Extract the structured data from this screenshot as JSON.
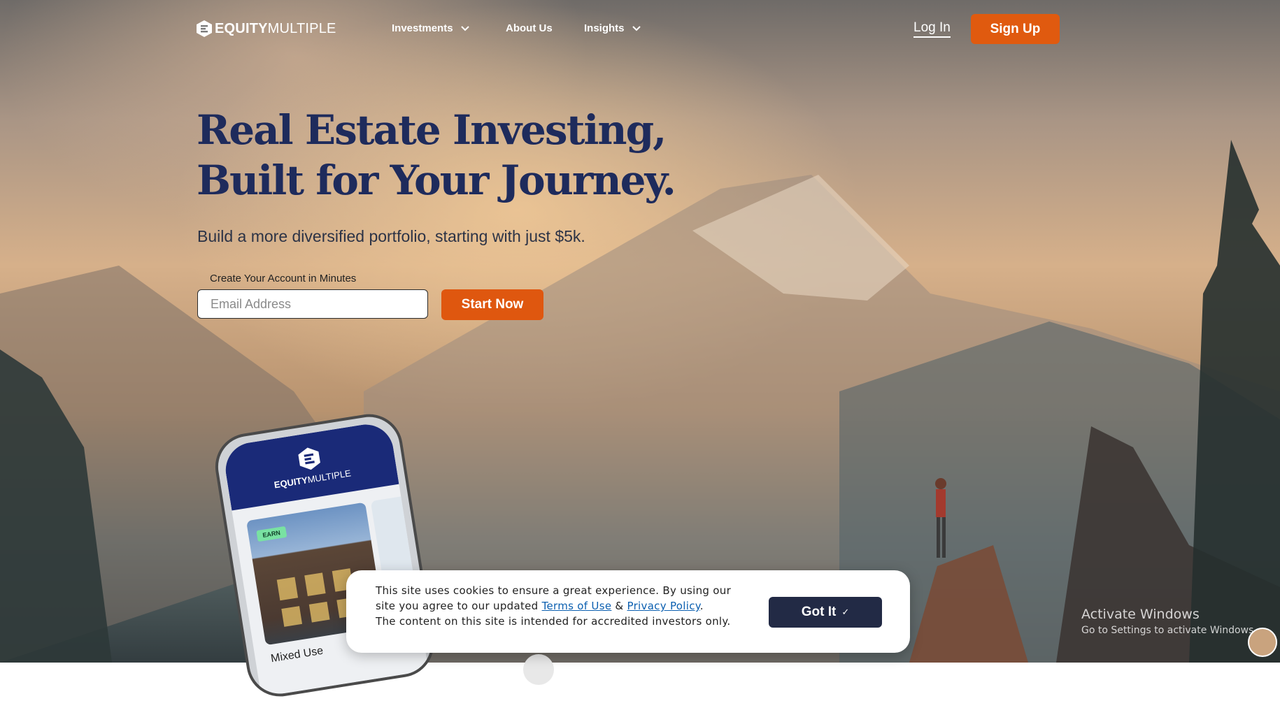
{
  "brand": {
    "bold": "EQUITY",
    "light": "MULTIPLE"
  },
  "nav": {
    "items": [
      {
        "label": "Investments",
        "has_dropdown": true
      },
      {
        "label": "About Us",
        "has_dropdown": false
      },
      {
        "label": "Insights",
        "has_dropdown": true
      }
    ],
    "login_label": "Log In",
    "signup_label": "Sign Up"
  },
  "hero": {
    "title_line1": "Real Estate Investing,",
    "title_line2": "Built for Your Journey.",
    "subtitle": "Build a more diversified portfolio, starting with just $5k.",
    "field_label": "Create Your Account in Minutes",
    "email_placeholder": "Email Address",
    "cta_label": "Start Now"
  },
  "phone": {
    "brand_bold": "EQUITY",
    "brand_light": "MULTIPLE",
    "badge": "EARN",
    "card_title": "Mixed Use"
  },
  "cookie": {
    "text_before": "This site uses cookies to ensure a great experience. By using our site you agree to our updated ",
    "terms_label": "Terms of Use",
    "amp": " & ",
    "privacy_label": "Privacy Policy",
    "period": ".",
    "line2": "The content on this site is intended for accredited investors only.",
    "button_label": "Got It",
    "button_icon": "checkmark-icon"
  },
  "windows_watermark": {
    "title": "Activate Windows",
    "subtitle": "Go to Settings to activate Windows."
  },
  "colors": {
    "accent_orange": "#e05a0f",
    "headline_navy": "#1e2b5c",
    "cookie_button": "#222a45"
  }
}
